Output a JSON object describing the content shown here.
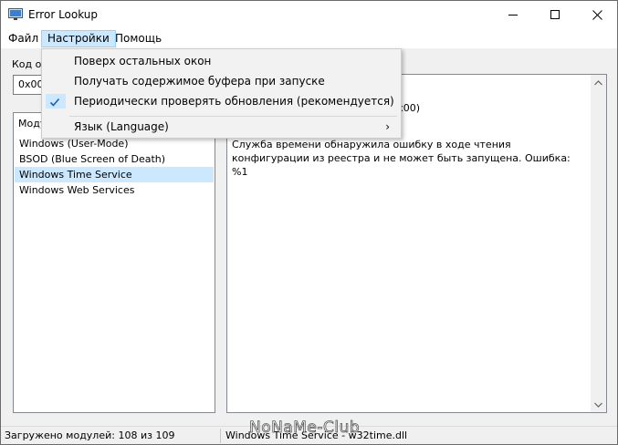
{
  "window": {
    "title": "Error Lookup",
    "controls": {
      "minimize": "—",
      "maximize": "☐",
      "close": "✕"
    }
  },
  "menubar": {
    "file": "Файл",
    "settings": "Настройки",
    "help": "Помощь"
  },
  "dropdown": {
    "items": [
      {
        "label": "Поверх остальных окон",
        "checked": false
      },
      {
        "label": "Получать содержимое буфера при запуске",
        "checked": false
      },
      {
        "label": "Периодически проверять обновления (рекомендуется)",
        "checked": true
      },
      {
        "label": "Язык (Language)",
        "submenu": true
      }
    ],
    "submenu_arrow": "›"
  },
  "form": {
    "code_label": "Код ош",
    "code_value": "0x000"
  },
  "modules": {
    "header": "Моду",
    "items": [
      {
        "label": "Windows (User-Mode)",
        "selected": false
      },
      {
        "label": "BSOD (Blue Screen of Death)",
        "selected": false
      },
      {
        "label": "Windows Time Service",
        "selected": true
      },
      {
        "label": "Windows Web Services",
        "selected": false
      }
    ]
  },
  "description": {
    "header_fragment": "(0x00)",
    "text": "Служба времени обнаружила ошибку в ходе чтения конфигурации из реестра и не может быть запущена. Ошибка: %1"
  },
  "statusbar": {
    "modules_loaded": "Загружено модулей: 108 из 109",
    "current_module": "Windows Time Service - w32time.dll"
  },
  "watermark": "NoNaMe-Club",
  "colors": {
    "selection": "#cce8ff",
    "menu_highlight_border": "#99d1ff",
    "window_bg": "#f0f0f0"
  }
}
